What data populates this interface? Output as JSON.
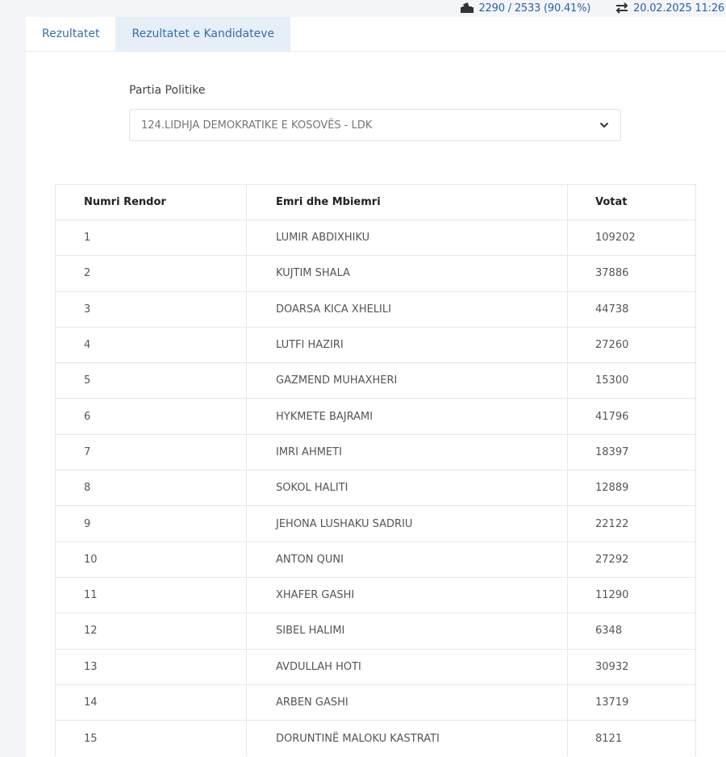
{
  "status": {
    "counting": "2290 / 2533 (90.41%)",
    "updated": "20.02.2025 11:26"
  },
  "tabs": [
    {
      "label": "Rezultatet",
      "active": false
    },
    {
      "label": "Rezultatet e Kandidateve",
      "active": true
    }
  ],
  "party": {
    "label": "Partia Politike",
    "selected": "124.LIDHJA DEMOKRATIKE E KOSOVËS - LDK"
  },
  "table": {
    "headers": [
      "Numri Rendor",
      "Emri dhe Mbiemri",
      "Votat"
    ],
    "rows": [
      [
        "1",
        "LUMIR ABDIXHIKU",
        "109202"
      ],
      [
        "2",
        "KUJTIM SHALA",
        "37886"
      ],
      [
        "3",
        "DOARSA KICA XHELILI",
        "44738"
      ],
      [
        "4",
        "LUTFI HAZIRI",
        "27260"
      ],
      [
        "5",
        "GAZMEND MUHAXHERI",
        "15300"
      ],
      [
        "6",
        "HYKMETE BAJRAMI",
        "41796"
      ],
      [
        "7",
        "IMRI AHMETI",
        "18397"
      ],
      [
        "8",
        "SOKOL HALITI",
        "12889"
      ],
      [
        "9",
        "JEHONA LUSHAKU SADRIU",
        "22122"
      ],
      [
        "10",
        "ANTON QUNI",
        "27292"
      ],
      [
        "11",
        "XHAFER GASHI",
        "11290"
      ],
      [
        "12",
        "SIBEL HALIMI",
        "6348"
      ],
      [
        "13",
        "AVDULLAH HOTI",
        "30932"
      ],
      [
        "14",
        "ARBEN GASHI",
        "13719"
      ],
      [
        "15",
        "DORUNTINË MALOKU KASTRATI",
        "8121"
      ]
    ]
  }
}
